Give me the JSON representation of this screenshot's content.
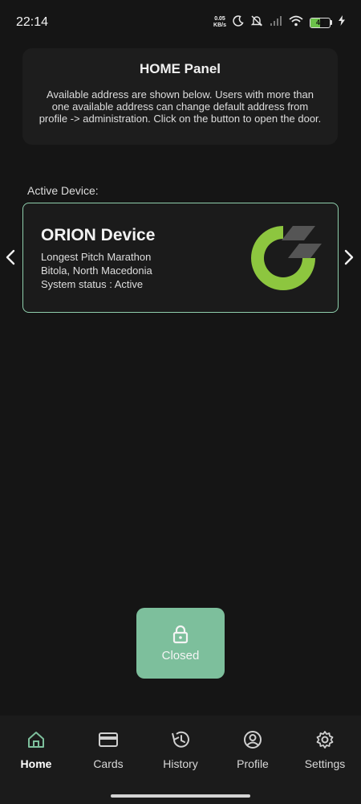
{
  "status_bar": {
    "time": "22:14",
    "net_speed_value": "0.05",
    "net_speed_unit": "KB/s",
    "battery_level": "49"
  },
  "info_panel": {
    "title": "HOME Panel",
    "text": "Available address are shown below. Users with more than one available address can change default address from profile -> administration. Click on the button to open the door."
  },
  "active_device": {
    "section_label": "Active Device:",
    "name": "ORION Device",
    "line1": "Longest Pitch Marathon",
    "line2": "Bitola, North Macedonia",
    "line3": "System status : Active"
  },
  "door_button": {
    "label": "Closed",
    "icon": "lock-icon"
  },
  "bottom_nav": {
    "items": [
      {
        "label": "Home",
        "icon": "home-icon"
      },
      {
        "label": "Cards",
        "icon": "card-icon"
      },
      {
        "label": "History",
        "icon": "history-icon"
      },
      {
        "label": "Profile",
        "icon": "profile-icon"
      },
      {
        "label": "Settings",
        "icon": "gear-icon"
      }
    ],
    "active": "Home"
  },
  "colors": {
    "accent": "#7dbf9c",
    "card_border": "#8fcfad",
    "logo_green": "#8dc63f",
    "background": "#151515"
  }
}
